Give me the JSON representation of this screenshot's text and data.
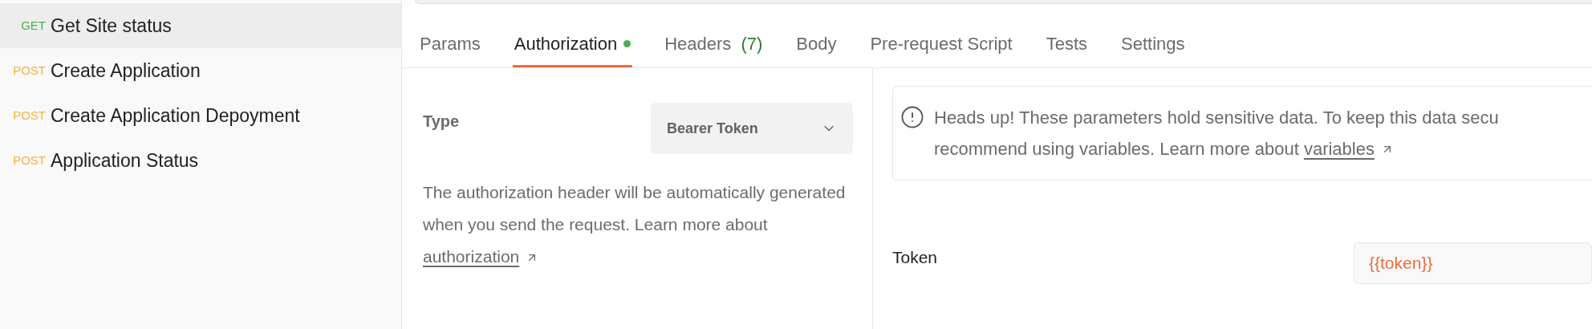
{
  "sidebar": {
    "items": [
      {
        "method": "GET",
        "name": "Get Site status",
        "selected": true
      },
      {
        "method": "POST",
        "name": "Create Application",
        "selected": false
      },
      {
        "method": "POST",
        "name": "Create Application Depoyment",
        "selected": false
      },
      {
        "method": "POST",
        "name": "Application Status",
        "selected": false
      }
    ]
  },
  "tabs": [
    {
      "label": "Params",
      "selected": false
    },
    {
      "label": "Authorization",
      "selected": true,
      "dot": true
    },
    {
      "label": "Headers",
      "count": "(7)",
      "selected": false
    },
    {
      "label": "Body",
      "selected": false
    },
    {
      "label": "Pre-request Script",
      "selected": false
    },
    {
      "label": "Tests",
      "selected": false
    },
    {
      "label": "Settings",
      "selected": false
    }
  ],
  "auth": {
    "type_label": "Type",
    "type_value": "Bearer Token",
    "description": "The authorization header will be automatically generated when you send the request. Learn more about",
    "description_link": "authorization"
  },
  "notice": {
    "line_1": "Heads up! These parameters hold sensitive data. To keep this data secu",
    "line_2": "recommend using variables. Learn more about",
    "link": "variables"
  },
  "token": {
    "label": "Token",
    "value": "{{token}}"
  }
}
